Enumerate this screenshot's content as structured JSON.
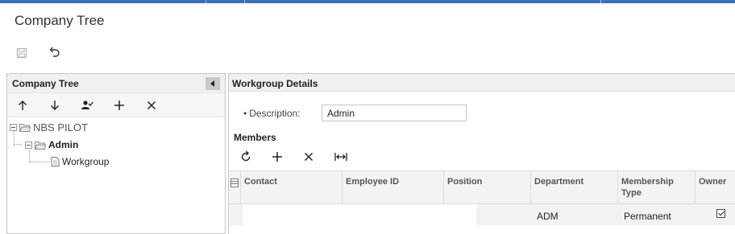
{
  "page": {
    "title": "Company Tree"
  },
  "toolbar": {
    "save_icon": "save-icon",
    "undo_icon": "undo-icon"
  },
  "left_panel": {
    "title": "Company Tree",
    "toolbar": [
      "move-up-icon",
      "move-down-icon",
      "assign-user-icon",
      "add-icon",
      "delete-icon"
    ],
    "tree": [
      {
        "label": "NBS PILOT",
        "bold": false
      },
      {
        "label": "Admin",
        "bold": true
      },
      {
        "label": "Workgroup",
        "bold": false
      }
    ]
  },
  "right_panel": {
    "title": "Workgroup Details",
    "description_label": "Description:",
    "description_value": "Admin",
    "members_title": "Members",
    "members_toolbar": [
      "refresh-icon",
      "add-icon",
      "delete-icon",
      "fit-columns-icon"
    ],
    "columns": [
      "Contact",
      "Employee ID",
      "Position",
      "Department",
      "Membership Type",
      "Owner"
    ],
    "rows": [
      {
        "contact": "",
        "employee_id": "",
        "position": "",
        "department": "ADM",
        "membership_type": "Permanent",
        "owner": true
      }
    ]
  },
  "colors": {
    "accent": "#3d6fb0",
    "panel_header": "#f0f0f0",
    "border": "#c8c8c8"
  }
}
